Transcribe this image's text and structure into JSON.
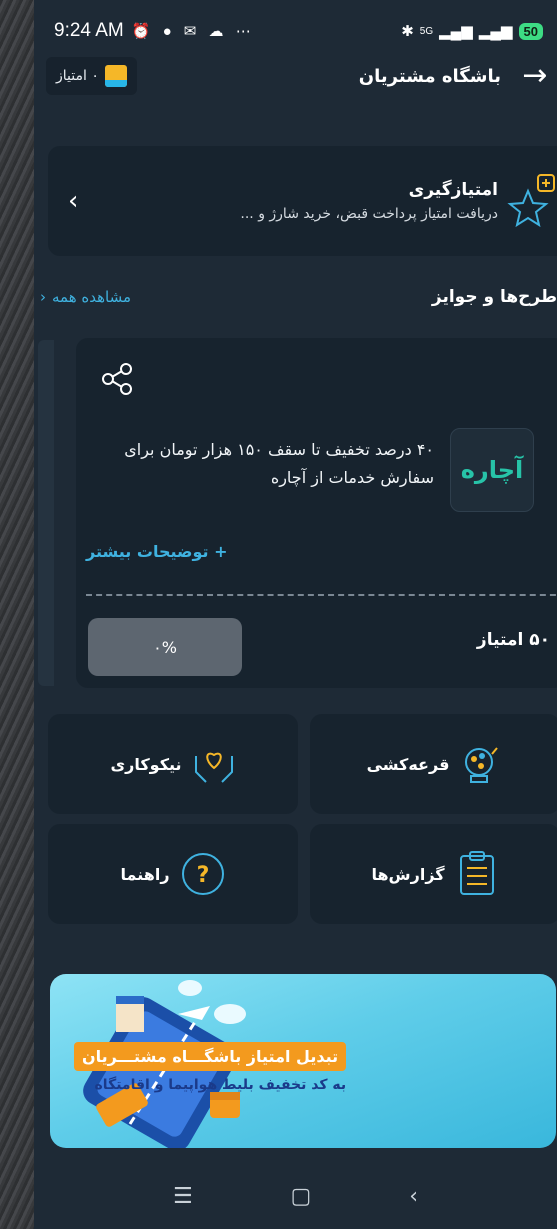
{
  "status_bar": {
    "time": "9:24 AM",
    "notification_icons": [
      "alarm-icon",
      "chat-icon",
      "message-icon",
      "cloud-icon",
      "more-icon"
    ],
    "network": "5G",
    "battery": "50"
  },
  "app_bar": {
    "title": "باشگاه مشتریان",
    "points_label": "۰ امتیاز"
  },
  "earn_card": {
    "title": "امتیازگیری",
    "subtitle": "دریافت امتیاز پرداخت قبض، خرید شارژ و ..."
  },
  "section": {
    "title": "طرح‌ها و جوایز",
    "see_all": "مشاهده همه"
  },
  "offer": {
    "logo_text": "آچاره",
    "description": "۴۰ درصد تخفیف تا سقف ۱۵۰ هزار تومان برای سفارش خدمات از آچاره",
    "more_info": "+ توضیحات بیشتر",
    "progress_label": "۰%",
    "cost": "۵۰ امتیاز"
  },
  "tiles": {
    "lottery": "قرعه‌کشی",
    "charity": "نیکوکاری",
    "reports": "گزارش‌ها",
    "guide": "راهنما"
  },
  "banner": {
    "line1": "تبدیل امتیاز باشگـــاه مشتـــریان",
    "line2": "به کد تخفیف بلیط هواپیما و اقامتگاه"
  },
  "colors": {
    "background": "#1e2a36",
    "card": "#17232e",
    "accent": "#3fb2e0",
    "gift": "#f5b728"
  }
}
